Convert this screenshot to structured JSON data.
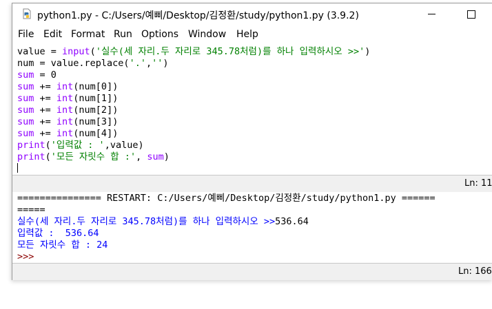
{
  "window": {
    "title": "python1.py - C:/Users/예삐/Desktop/김정환/study/python1.py (3.9.2)",
    "icon": "python-file-icon"
  },
  "menu": [
    "File",
    "Edit",
    "Format",
    "Run",
    "Options",
    "Window",
    "Help"
  ],
  "editor": {
    "code_lines": [
      {
        "parts": [
          {
            "t": "value = ",
            "c": "plain"
          },
          {
            "t": "input",
            "c": "bi"
          },
          {
            "t": "(",
            "c": "plain"
          },
          {
            "t": "'실수(세 자리.두 자리로 345.78처럼)를 하나 입력하시오 >>'",
            "c": "str"
          },
          {
            "t": ")",
            "c": "plain"
          }
        ]
      },
      {
        "parts": [
          {
            "t": "num = value.replace(",
            "c": "plain"
          },
          {
            "t": "'.'",
            "c": "str"
          },
          {
            "t": ",",
            "c": "plain"
          },
          {
            "t": "''",
            "c": "str"
          },
          {
            "t": ")",
            "c": "plain"
          }
        ]
      },
      {
        "parts": [
          {
            "t": "sum",
            "c": "bi"
          },
          {
            "t": " = 0",
            "c": "plain"
          }
        ]
      },
      {
        "parts": [
          {
            "t": "sum",
            "c": "bi"
          },
          {
            "t": " += ",
            "c": "plain"
          },
          {
            "t": "int",
            "c": "bi"
          },
          {
            "t": "(num[0])",
            "c": "plain"
          }
        ]
      },
      {
        "parts": [
          {
            "t": "sum",
            "c": "bi"
          },
          {
            "t": " += ",
            "c": "plain"
          },
          {
            "t": "int",
            "c": "bi"
          },
          {
            "t": "(num[1])",
            "c": "plain"
          }
        ]
      },
      {
        "parts": [
          {
            "t": "sum",
            "c": "bi"
          },
          {
            "t": " += ",
            "c": "plain"
          },
          {
            "t": "int",
            "c": "bi"
          },
          {
            "t": "(num[2])",
            "c": "plain"
          }
        ]
      },
      {
        "parts": [
          {
            "t": "sum",
            "c": "bi"
          },
          {
            "t": " += ",
            "c": "plain"
          },
          {
            "t": "int",
            "c": "bi"
          },
          {
            "t": "(num[3])",
            "c": "plain"
          }
        ]
      },
      {
        "parts": [
          {
            "t": "sum",
            "c": "bi"
          },
          {
            "t": " += ",
            "c": "plain"
          },
          {
            "t": "int",
            "c": "bi"
          },
          {
            "t": "(num[4])",
            "c": "plain"
          }
        ]
      },
      {
        "parts": [
          {
            "t": "print",
            "c": "bi"
          },
          {
            "t": "(",
            "c": "plain"
          },
          {
            "t": "'입력값 : '",
            "c": "str"
          },
          {
            "t": ",value)",
            "c": "plain"
          }
        ]
      },
      {
        "parts": [
          {
            "t": "print",
            "c": "bi"
          },
          {
            "t": "(",
            "c": "plain"
          },
          {
            "t": "'모든 자릿수 합 :'",
            "c": "str"
          },
          {
            "t": ", ",
            "c": "plain"
          },
          {
            "t": "sum",
            "c": "bi"
          },
          {
            "t": ")",
            "c": "plain"
          }
        ]
      }
    ],
    "status": "Ln: 11"
  },
  "shell": {
    "restart_line": "=============== RESTART: C:/Users/예삐/Desktop/김정환/study/python1.py ======",
    "restart_wrap": "=====",
    "input_prompt": "실수(세 자리.두 자리로 345.78처럼)를 하나 입력하시오 >>",
    "input_value": "536.64",
    "output_1": "입력값 :  536.64",
    "output_2": "모든 자릿수 합 : 24",
    "prompt": ">>>",
    "status": "Ln: 166"
  },
  "colors": {
    "keyword_builtin": "#8f00ff",
    "string": "#008000",
    "shell_output": "#0000ff",
    "shell_prompt": "#8b0000"
  }
}
